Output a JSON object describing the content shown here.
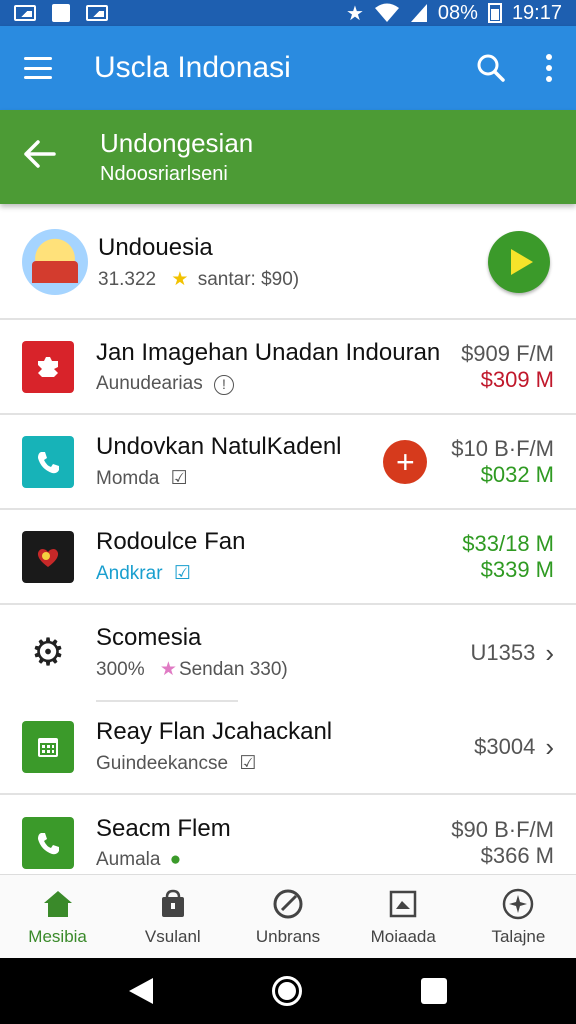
{
  "status": {
    "battery": "08%",
    "time": "19:17"
  },
  "appbar": {
    "title": "Uscla Indonasi"
  },
  "subbar": {
    "title": "Undongesian",
    "subtitle": "Ndoosriarlseni"
  },
  "featured": {
    "title": "Undouesia",
    "count": "31.322",
    "star": "★",
    "meta": "santar: $90)"
  },
  "rows": [
    {
      "title": "Jan Imagehan Unadan Indouran",
      "sub": "Aunudearias",
      "price1": "$909 F/M",
      "price2": "$309 M",
      "price1_color": "#555555",
      "price2_color": "#c0182b"
    },
    {
      "title": "Undovkan NatulKadenl",
      "sub": "Momda",
      "price1": "$10 B·F/M",
      "price2": "$032 M",
      "price1_color": "#555555",
      "price2_color": "#2f9a22"
    },
    {
      "title": "Rodoulce Fan",
      "sub": "Andkrar",
      "price1": "$33/18 M",
      "price2": "$339 M",
      "price1_color": "#2f9a22",
      "price2_color": "#2f9a22"
    },
    {
      "title": "Scomesia",
      "sub_count": "300%",
      "sub_star": "★",
      "sub_meta": "Sendan 330)",
      "value": "U1353"
    },
    {
      "title": "Reay Flan Jcahackanl",
      "sub": "Guindeekancse",
      "value": "$3004"
    },
    {
      "title": "Seacm Flem",
      "sub": "Aumala",
      "price1": "$90 B·F/M",
      "price2": "$366 M"
    }
  ],
  "nav": [
    {
      "label": "Mesibia",
      "icon": "home-icon"
    },
    {
      "label": "Vsulanl",
      "icon": "bag-icon"
    },
    {
      "label": "Unbrans",
      "icon": "compass-icon"
    },
    {
      "label": "Moiaada",
      "icon": "image-icon"
    },
    {
      "label": "Talajne",
      "icon": "star-badge-icon"
    }
  ],
  "colors": {
    "primary": "#2a8be0",
    "statusbar": "#1e5fb0",
    "green": "#4c9b35",
    "accent_red": "#d63a1c"
  }
}
